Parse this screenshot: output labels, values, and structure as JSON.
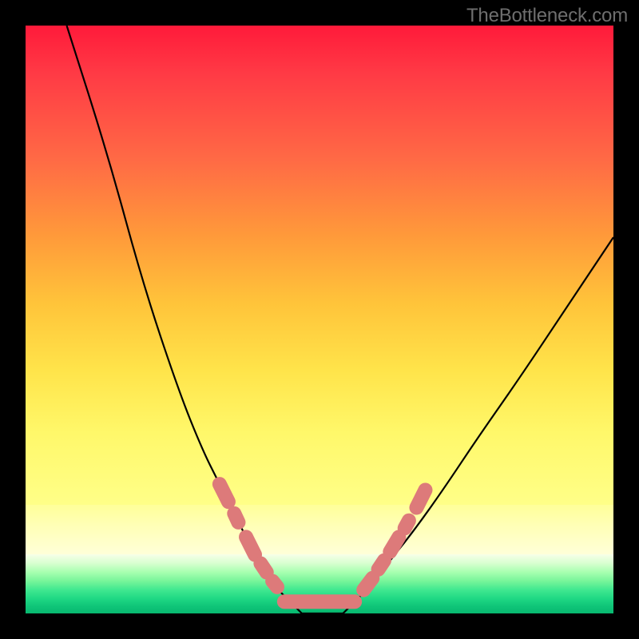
{
  "watermark": "TheBottleneck.com",
  "colors": {
    "frame": "#000000",
    "marker": "#dd7a7a",
    "curve": "#000000",
    "watermark_text": "#6e6e6e"
  },
  "chart_data": {
    "type": "line",
    "title": "",
    "xlabel": "",
    "ylabel": "",
    "xlim": [
      0,
      100
    ],
    "ylim": [
      0,
      100
    ],
    "series": [
      {
        "name": "left-curve",
        "x": [
          7,
          14,
          20,
          26,
          30,
          33,
          36,
          38,
          40,
          42,
          44,
          46,
          47
        ],
        "values": [
          100,
          78,
          56,
          38,
          28,
          22,
          16,
          12,
          8,
          5,
          3,
          1,
          0
        ]
      },
      {
        "name": "right-curve",
        "x": [
          54,
          56,
          59,
          62,
          66,
          71,
          77,
          84,
          92,
          100
        ],
        "values": [
          0,
          2,
          5,
          9,
          14,
          21,
          30,
          40,
          52,
          64
        ]
      },
      {
        "name": "flat-bottom",
        "x": [
          47,
          54
        ],
        "values": [
          0,
          0
        ]
      }
    ],
    "highlighted_segments": {
      "description": "pink capsule markers along both curves near the bottom and across the trough",
      "left_asc": [
        {
          "x0": 33,
          "y0": 22,
          "x1": 34.5,
          "y1": 19
        },
        {
          "x0": 35.5,
          "y0": 17,
          "x1": 36.2,
          "y1": 15.5
        },
        {
          "x0": 37.5,
          "y0": 13,
          "x1": 39,
          "y1": 10
        },
        {
          "x0": 40,
          "y0": 8.5,
          "x1": 41,
          "y1": 7
        },
        {
          "x0": 42,
          "y0": 5.5,
          "x1": 42.8,
          "y1": 4.5
        }
      ],
      "trough": [
        {
          "x0": 44,
          "y0": 2,
          "x1": 56,
          "y1": 2
        }
      ],
      "right_asc": [
        {
          "x0": 57.5,
          "y0": 4,
          "x1": 59,
          "y1": 6
        },
        {
          "x0": 60,
          "y0": 7.5,
          "x1": 61,
          "y1": 9
        },
        {
          "x0": 62,
          "y0": 10.5,
          "x1": 63.5,
          "y1": 13
        },
        {
          "x0": 64.5,
          "y0": 14.5,
          "x1": 65.2,
          "y1": 15.8
        },
        {
          "x0": 66.5,
          "y0": 18,
          "x1": 68,
          "y1": 21
        }
      ]
    }
  }
}
